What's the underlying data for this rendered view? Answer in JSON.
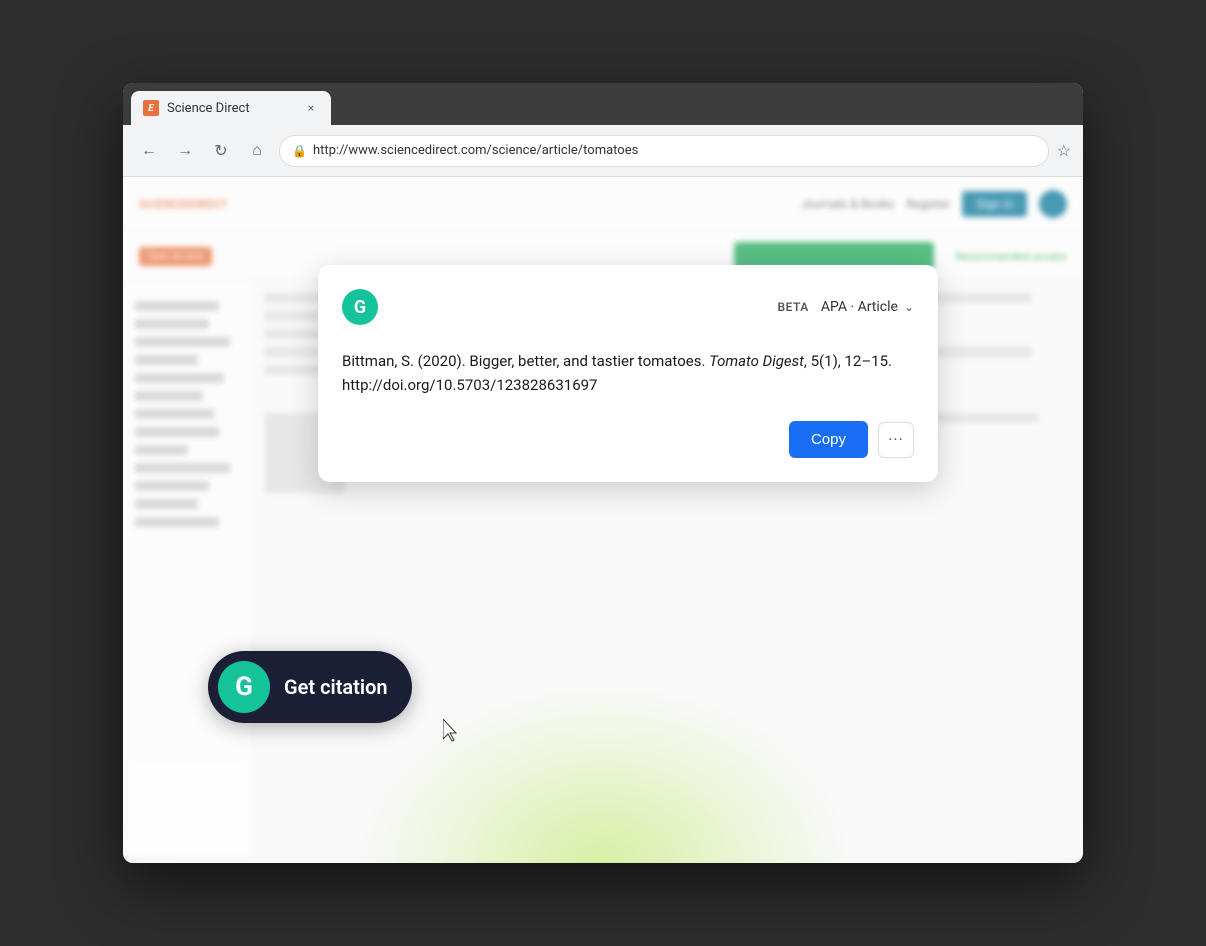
{
  "browser": {
    "tab_favicon": "E",
    "tab_title": "Science Direct",
    "url": "http://www.sciencedirect.com/science/article/tomatoes",
    "tab_close": "×"
  },
  "nav": {
    "back": "←",
    "forward": "→",
    "refresh": "↻",
    "home": "⌂",
    "star": "☆"
  },
  "page": {
    "logo": "ScienceDirect",
    "header_link1": "Journals & Books",
    "header_link2": "Register",
    "signin_label": "Sign in",
    "user_avatar": ""
  },
  "popup": {
    "beta_label": "BETA",
    "style_label": "APA · Article",
    "citation_text_plain": "Bittman, S. (2020). Bigger, better, and tastier tomatoes. ",
    "citation_italic": "Tomato Digest",
    "citation_after_italic": ", 5(1), 12–15.",
    "citation_doi": "http://doi.org/10.5703/123828631697",
    "copy_label": "Copy",
    "more_dots": "···"
  },
  "get_citation": {
    "label": "Get citation",
    "icon_letter": "G"
  },
  "icons": {
    "grammarly_letter": "G",
    "lock": "🔒",
    "chevron_down": "⌄"
  }
}
